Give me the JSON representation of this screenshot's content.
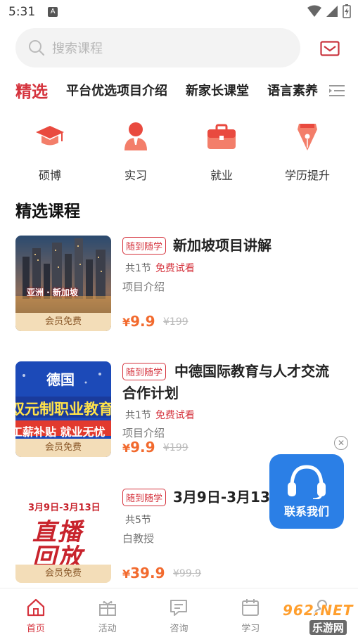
{
  "status": {
    "time": "5:31",
    "notif": "A"
  },
  "search": {
    "placeholder": "搜索课程"
  },
  "tabs": [
    {
      "label": "精选"
    },
    {
      "label": "平台优选项目介绍"
    },
    {
      "label": "新家长课堂"
    },
    {
      "label": "语言素养"
    }
  ],
  "categories": [
    {
      "label": "硕博",
      "icon": "graduation-cap-icon"
    },
    {
      "label": "实习",
      "icon": "intern-person-icon"
    },
    {
      "label": "就业",
      "icon": "briefcase-icon"
    },
    {
      "label": "学历提升",
      "icon": "pen-nib-icon"
    }
  ],
  "section_title": "精选课程",
  "courses": [
    {
      "tag": "随到随学",
      "title": "新加坡项目讲解",
      "lessons": "共1节",
      "free": "免费试看",
      "desc": "项目介绍",
      "yen": "¥",
      "price": "9.9",
      "orig": "¥199",
      "badge": "会员免费",
      "thumb_text": "亚洲 · 新加坡"
    },
    {
      "tag": "随到随学",
      "title": "中德国际教育与人才交流合作计划",
      "lessons": "共1节",
      "free": "免费试看",
      "desc": "项目介绍",
      "yen": "¥",
      "price": "9.9",
      "orig": "¥199",
      "badge": "会员免费",
      "thumb_line1": "德国",
      "thumb_line2": "双元制职业教育",
      "thumb_line3": "工薪补贴 就业无忧"
    },
    {
      "tag": "随到随学",
      "title": "3月9日-3月13日",
      "lessons": "共5节",
      "free": "",
      "desc": "白教授",
      "yen": "¥",
      "price": "39.9",
      "orig": "¥99.9",
      "badge": "会员免费",
      "thumb_line1": "3月9日-3月13日",
      "thumb_line2": "直播",
      "thumb_line3": "回放"
    }
  ],
  "float_contact": {
    "label": "联系我们"
  },
  "bottom_nav": [
    {
      "label": "首页",
      "icon": "home-icon"
    },
    {
      "label": "活动",
      "icon": "gift-icon"
    },
    {
      "label": "咨询",
      "icon": "chat-icon"
    },
    {
      "label": "学习",
      "icon": "calendar-icon"
    },
    {
      "label": "我的",
      "icon": "user-icon"
    }
  ],
  "watermark": {
    "line1": "962.NET",
    "line2": "乐游网"
  },
  "colors": {
    "accent": "#d5333d",
    "price": "#f26a2e",
    "contact": "#2b7fe6"
  }
}
